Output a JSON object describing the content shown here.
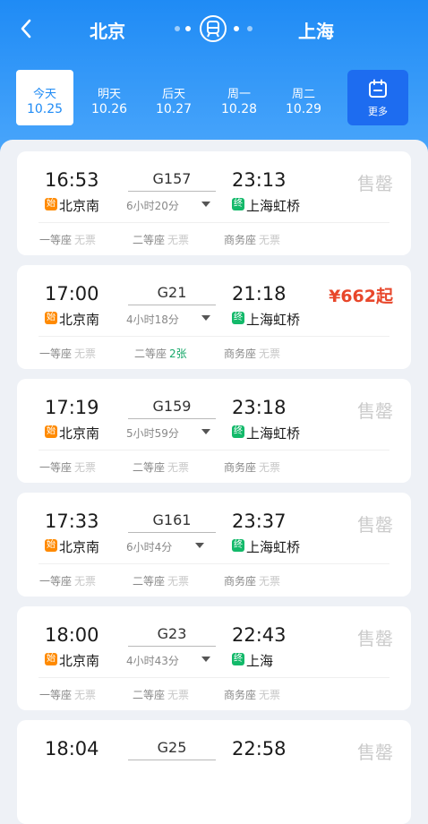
{
  "route": {
    "from": "北京",
    "to": "上海"
  },
  "dates": [
    {
      "day": "今天",
      "date": "10.25",
      "active": true
    },
    {
      "day": "明天",
      "date": "10.26",
      "active": false
    },
    {
      "day": "后天",
      "date": "10.27",
      "active": false
    },
    {
      "day": "周一",
      "date": "10.28",
      "active": false
    },
    {
      "day": "周二",
      "date": "10.29",
      "active": false
    }
  ],
  "more_label": "更多",
  "trains": [
    {
      "dep_time": "16:53",
      "arr_time": "23:13",
      "train_no": "G157",
      "duration": "6小时20分",
      "start_badge": "始",
      "dep_station": "北京南",
      "end_badge": "终",
      "arr_station": "上海虹桥",
      "status": "售罄",
      "is_price": false,
      "seats": [
        {
          "name": "一等座",
          "value": "无票",
          "avail": false
        },
        {
          "name": "二等座",
          "value": "无票",
          "avail": false
        },
        {
          "name": "商务座",
          "value": "无票",
          "avail": false
        }
      ]
    },
    {
      "dep_time": "17:00",
      "arr_time": "21:18",
      "train_no": "G21",
      "duration": "4小时18分",
      "start_badge": "始",
      "dep_station": "北京南",
      "end_badge": "终",
      "arr_station": "上海虹桥",
      "status": "¥662起",
      "is_price": true,
      "seats": [
        {
          "name": "一等座",
          "value": "无票",
          "avail": false
        },
        {
          "name": "二等座",
          "value": "2张",
          "avail": true
        },
        {
          "name": "商务座",
          "value": "无票",
          "avail": false
        }
      ]
    },
    {
      "dep_time": "17:19",
      "arr_time": "23:18",
      "train_no": "G159",
      "duration": "5小时59分",
      "start_badge": "始",
      "dep_station": "北京南",
      "end_badge": "终",
      "arr_station": "上海虹桥",
      "status": "售罄",
      "is_price": false,
      "seats": [
        {
          "name": "一等座",
          "value": "无票",
          "avail": false
        },
        {
          "name": "二等座",
          "value": "无票",
          "avail": false
        },
        {
          "name": "商务座",
          "value": "无票",
          "avail": false
        }
      ]
    },
    {
      "dep_time": "17:33",
      "arr_time": "23:37",
      "train_no": "G161",
      "duration": "6小时4分",
      "start_badge": "始",
      "dep_station": "北京南",
      "end_badge": "终",
      "arr_station": "上海虹桥",
      "status": "售罄",
      "is_price": false,
      "seats": [
        {
          "name": "一等座",
          "value": "无票",
          "avail": false
        },
        {
          "name": "二等座",
          "value": "无票",
          "avail": false
        },
        {
          "name": "商务座",
          "value": "无票",
          "avail": false
        }
      ]
    },
    {
      "dep_time": "18:00",
      "arr_time": "22:43",
      "train_no": "G23",
      "duration": "4小时43分",
      "start_badge": "始",
      "dep_station": "北京南",
      "end_badge": "终",
      "arr_station": "上海",
      "status": "售罄",
      "is_price": false,
      "seats": [
        {
          "name": "一等座",
          "value": "无票",
          "avail": false
        },
        {
          "name": "二等座",
          "value": "无票",
          "avail": false
        },
        {
          "name": "商务座",
          "value": "无票",
          "avail": false
        }
      ]
    },
    {
      "dep_time": "18:04",
      "arr_time": "22:58",
      "train_no": "G25",
      "duration": "",
      "start_badge": "",
      "dep_station": "",
      "end_badge": "",
      "arr_station": "",
      "status": "售罄",
      "is_price": false,
      "seats": []
    }
  ],
  "colors": {
    "header": "#1f8bf5",
    "price": "#e8472b",
    "available": "#17a86a",
    "start_badge": "#ff8a00",
    "end_badge": "#13b96a"
  }
}
